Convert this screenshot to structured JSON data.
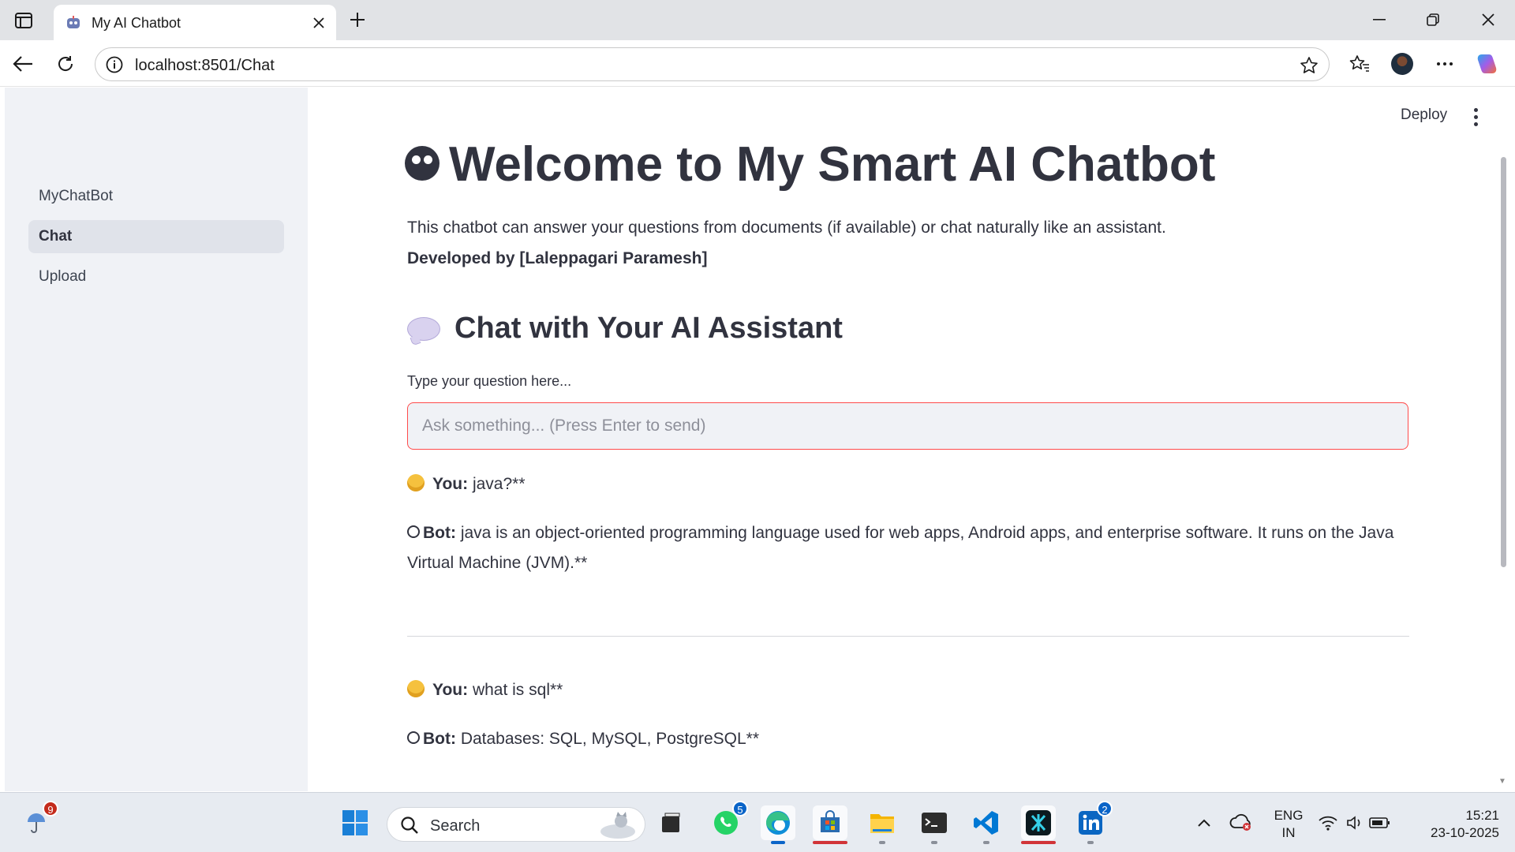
{
  "browser": {
    "tab_title": "My AI Chatbot",
    "url": "localhost:8501/Chat"
  },
  "sidebar": {
    "items": [
      {
        "label": "MyChatBot"
      },
      {
        "label": "Chat"
      },
      {
        "label": "Upload"
      }
    ]
  },
  "header": {
    "deploy_label": "Deploy"
  },
  "main": {
    "title": "Welcome to My Smart AI Chatbot",
    "description": "This chatbot can answer your questions from documents (if available) or chat naturally like an assistant.",
    "credit": "Developed by [Laleppagari Paramesh]",
    "section_title": "Chat with Your AI Assistant",
    "input_label": "Type your question here...",
    "input_placeholder": "Ask something... (Press Enter to send)"
  },
  "conversation": [
    {
      "user_label": "You:",
      "user_text": "java?**",
      "bot_label": "Bot:",
      "bot_text": "java is an object-oriented programming language used for web apps, Android apps, and enterprise software. It runs on the Java Virtual Machine (JVM).**"
    },
    {
      "user_label": "You:",
      "user_text": "what is sql**",
      "bot_label": "Bot:",
      "bot_text": "Databases: SQL, MySQL, PostgreSQL**"
    }
  ],
  "taskbar": {
    "search_label": "Search",
    "weather_badge": "9",
    "whatsapp_badge": "5",
    "linkedin_badge": "2",
    "lang_line1": "ENG",
    "lang_line2": "IN",
    "time": "15:21",
    "date": "23-10-2025"
  },
  "colors": {
    "accent": "#ff4b4b",
    "sidebar_bg": "#f0f2f6",
    "text": "#31333f"
  }
}
